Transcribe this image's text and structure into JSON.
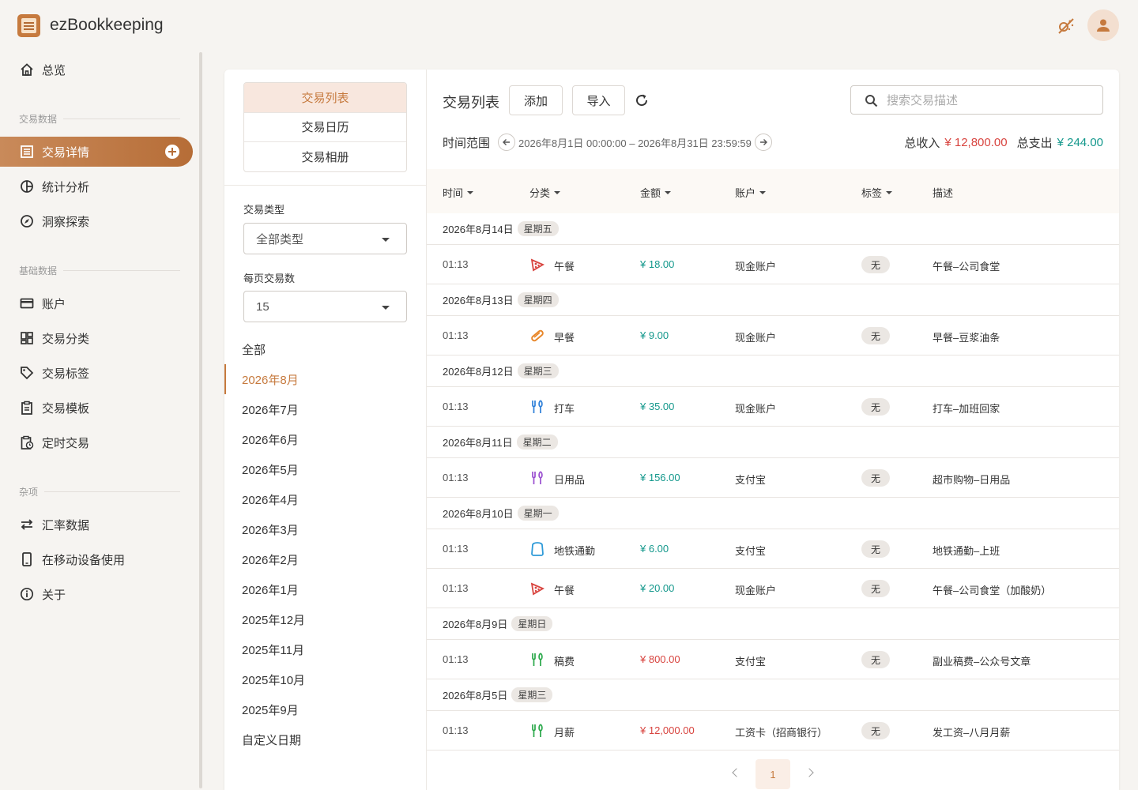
{
  "app": {
    "title": "ezBookkeeping"
  },
  "icons": {
    "logo": "notebook-logo",
    "theme": "theme-toggle-icon",
    "user": "account-icon"
  },
  "colors": {
    "accent": "#c67a3e",
    "income": "#d8443f",
    "expense": "#14988c"
  },
  "sidebar": {
    "overview": "总览",
    "section_tx": "交易数据",
    "tx_details": "交易详情",
    "statistics": "统计分析",
    "insights": "洞察探索",
    "section_basic": "基础数据",
    "accounts": "账户",
    "categories": "交易分类",
    "tags": "交易标签",
    "templates": "交易模板",
    "scheduled": "定时交易",
    "section_misc": "杂项",
    "exchange": "汇率数据",
    "mobile": "在移动设备使用",
    "about": "关于"
  },
  "left": {
    "tabs": [
      "交易列表",
      "交易日历",
      "交易相册"
    ],
    "type_label": "交易类型",
    "type_value": "全部类型",
    "per_page_label": "每页交易数",
    "per_page_value": "15",
    "ranges": [
      "全部",
      "2026年8月",
      "2026年7月",
      "2026年6月",
      "2026年5月",
      "2026年4月",
      "2026年3月",
      "2026年2月",
      "2026年1月",
      "2025年12月",
      "2025年11月",
      "2025年10月",
      "2025年9月",
      "自定义日期"
    ],
    "active_range": "2026年8月"
  },
  "main": {
    "title": "交易列表",
    "add": "添加",
    "import": "导入",
    "search_placeholder": "搜索交易描述",
    "range_label": "时间范围",
    "range_value": "2026年8月1日 00:00:00 – 2026年8月31日 23:59:59",
    "income_label": "总收入",
    "income_value": "¥ 12,800.00",
    "expense_label": "总支出",
    "expense_value": "¥ 244.00",
    "columns": [
      "时间",
      "分类",
      "金额",
      "账户",
      "标签",
      "描述"
    ],
    "page": "1"
  },
  "groups": [
    {
      "date": "2026年8月14日",
      "weekday": "星期五",
      "rows": [
        {
          "time": "01:13",
          "icon": "pizza-icon",
          "icon_color": "#d8443f",
          "category": "午餐",
          "amount": "¥ 18.00",
          "kind": "expense",
          "account": "现金账户",
          "tag": "无",
          "desc": "午餐–公司食堂"
        }
      ]
    },
    {
      "date": "2026年8月13日",
      "weekday": "星期四",
      "rows": [
        {
          "time": "01:13",
          "icon": "hotdog-icon",
          "icon_color": "#e8872a",
          "category": "早餐",
          "amount": "¥ 9.00",
          "kind": "expense",
          "account": "现金账户",
          "tag": "无",
          "desc": "早餐–豆浆油条"
        }
      ]
    },
    {
      "date": "2026年8月12日",
      "weekday": "星期三",
      "rows": [
        {
          "time": "01:13",
          "icon": "utensils-icon",
          "icon_color": "#2e7fd8",
          "category": "打车",
          "amount": "¥ 35.00",
          "kind": "expense",
          "account": "现金账户",
          "tag": "无",
          "desc": "打车–加班回家"
        }
      ]
    },
    {
      "date": "2026年8月11日",
      "weekday": "星期二",
      "rows": [
        {
          "time": "01:13",
          "icon": "utensils-icon",
          "icon_color": "#9a4fd0",
          "category": "日用品",
          "amount": "¥ 156.00",
          "kind": "expense",
          "account": "支付宝",
          "tag": "无",
          "desc": "超市购物–日用品"
        }
      ]
    },
    {
      "date": "2026年8月10日",
      "weekday": "星期一",
      "rows": [
        {
          "time": "01:13",
          "icon": "shirt-icon",
          "icon_color": "#2e9ad8",
          "category": "地铁通勤",
          "amount": "¥ 6.00",
          "kind": "expense",
          "account": "支付宝",
          "tag": "无",
          "desc": "地铁通勤–上班"
        },
        {
          "time": "01:13",
          "icon": "pizza-icon",
          "icon_color": "#d8443f",
          "category": "午餐",
          "amount": "¥ 20.00",
          "kind": "expense",
          "account": "现金账户",
          "tag": "无",
          "desc": "午餐–公司食堂（加酸奶）"
        }
      ]
    },
    {
      "date": "2026年8月9日",
      "weekday": "星期日",
      "rows": [
        {
          "time": "01:13",
          "icon": "utensils-icon",
          "icon_color": "#2aa84a",
          "category": "稿费",
          "amount": "¥ 800.00",
          "kind": "income",
          "account": "支付宝",
          "tag": "无",
          "desc": "副业稿费–公众号文章"
        }
      ]
    },
    {
      "date": "2026年8月5日",
      "weekday": "星期三",
      "rows": [
        {
          "time": "01:13",
          "icon": "utensils-icon",
          "icon_color": "#2aa84a",
          "category": "月薪",
          "amount": "¥ 12,000.00",
          "kind": "income",
          "account": "工资卡（招商银行）",
          "tag": "无",
          "desc": "发工资–八月月薪"
        }
      ]
    }
  ]
}
